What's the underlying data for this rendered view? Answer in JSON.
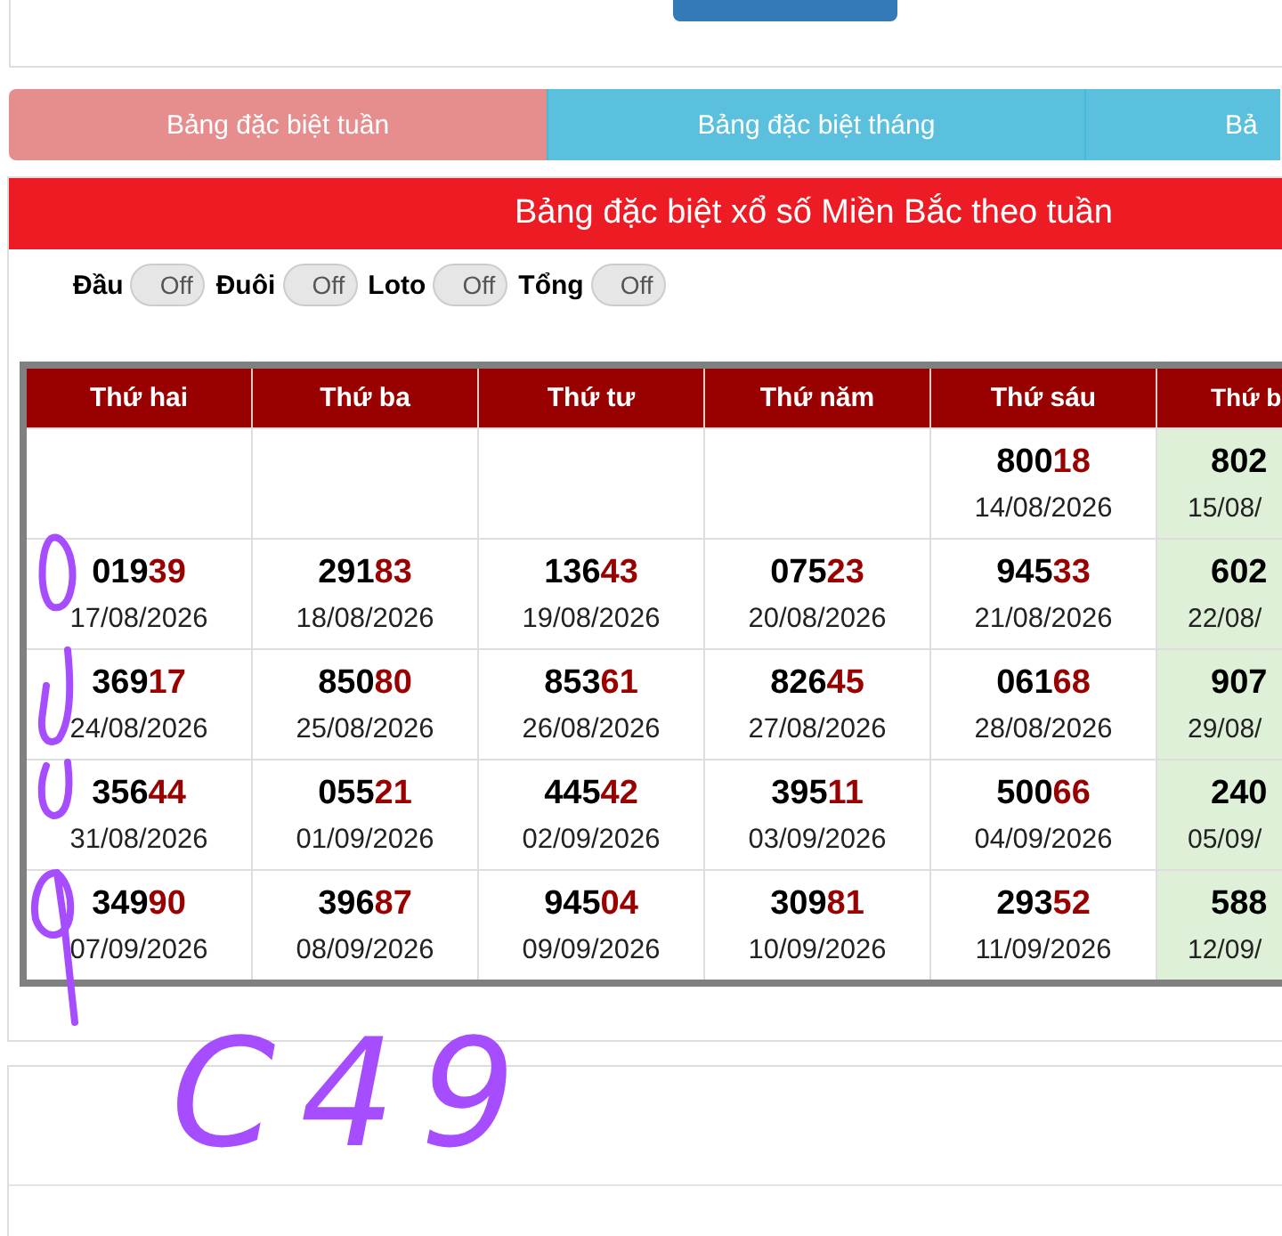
{
  "tabs": [
    {
      "label": "Bảng đặc biệt tuần",
      "selected": true
    },
    {
      "label": "Bảng đặc biệt tháng",
      "selected": false
    },
    {
      "label": "Bả",
      "selected": false
    }
  ],
  "panel_title": "Bảng đặc biệt xổ số Miền Bắc theo tuần",
  "toggles": [
    {
      "label": "Đầu",
      "state": "Off",
      "on": false
    },
    {
      "label": "Đuôi",
      "state": "Off",
      "on": false
    },
    {
      "label": "Loto",
      "state": "Off",
      "on": false
    },
    {
      "label": "Tổng",
      "state": "Off",
      "on": false
    }
  ],
  "table": {
    "columns": [
      "Thứ hai",
      "Thứ ba",
      "Thứ tư",
      "Thứ năm",
      "Thứ sáu",
      "Thứ b"
    ],
    "rows": [
      [
        null,
        null,
        null,
        null,
        {
          "head": "800",
          "tail": "18",
          "date": "14/08/2026"
        },
        {
          "head": "802",
          "date": "15/08/"
        }
      ],
      [
        {
          "head": "019",
          "tail": "39",
          "date": "17/08/2026"
        },
        {
          "head": "291",
          "tail": "83",
          "date": "18/08/2026"
        },
        {
          "head": "136",
          "tail": "43",
          "date": "19/08/2026"
        },
        {
          "head": "075",
          "tail": "23",
          "date": "20/08/2026"
        },
        {
          "head": "945",
          "tail": "33",
          "date": "21/08/2026"
        },
        {
          "head": "602",
          "date": "22/08/"
        }
      ],
      [
        {
          "head": "369",
          "tail": "17",
          "date": "24/08/2026"
        },
        {
          "head": "850",
          "tail": "80",
          "date": "25/08/2026"
        },
        {
          "head": "853",
          "tail": "61",
          "date": "26/08/2026"
        },
        {
          "head": "826",
          "tail": "45",
          "date": "27/08/2026"
        },
        {
          "head": "061",
          "tail": "68",
          "date": "28/08/2026"
        },
        {
          "head": "907",
          "date": "29/08/"
        }
      ],
      [
        {
          "head": "356",
          "tail": "44",
          "date": "31/08/2026"
        },
        {
          "head": "055",
          "tail": "21",
          "date": "01/09/2026"
        },
        {
          "head": "445",
          "tail": "42",
          "date": "02/09/2026"
        },
        {
          "head": "395",
          "tail": "11",
          "date": "03/09/2026"
        },
        {
          "head": "500",
          "tail": "66",
          "date": "04/09/2026"
        },
        {
          "head": "240",
          "date": "05/09/"
        }
      ],
      [
        {
          "head": "349",
          "tail": "90",
          "date": "07/09/2026"
        },
        {
          "head": "396",
          "tail": "87",
          "date": "08/09/2026"
        },
        {
          "head": "945",
          "tail": "04",
          "date": "09/09/2026"
        },
        {
          "head": "309",
          "tail": "81",
          "date": "10/09/2026"
        },
        {
          "head": "293",
          "tail": "52",
          "date": "11/09/2026"
        },
        {
          "head": "588",
          "date": "12/09/"
        }
      ]
    ]
  },
  "annotation": {
    "text": "C49"
  }
}
